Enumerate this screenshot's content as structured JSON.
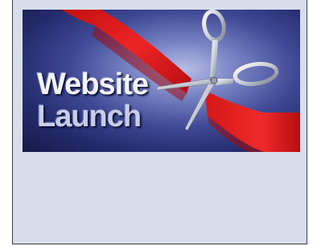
{
  "banner": {
    "line1": "Website",
    "line2": "Launch",
    "ribbon_color": "#e01b1b",
    "background_color": "#2a3278",
    "icon": "scissors-icon"
  },
  "panel": {
    "background_color": "#d8dde9"
  }
}
